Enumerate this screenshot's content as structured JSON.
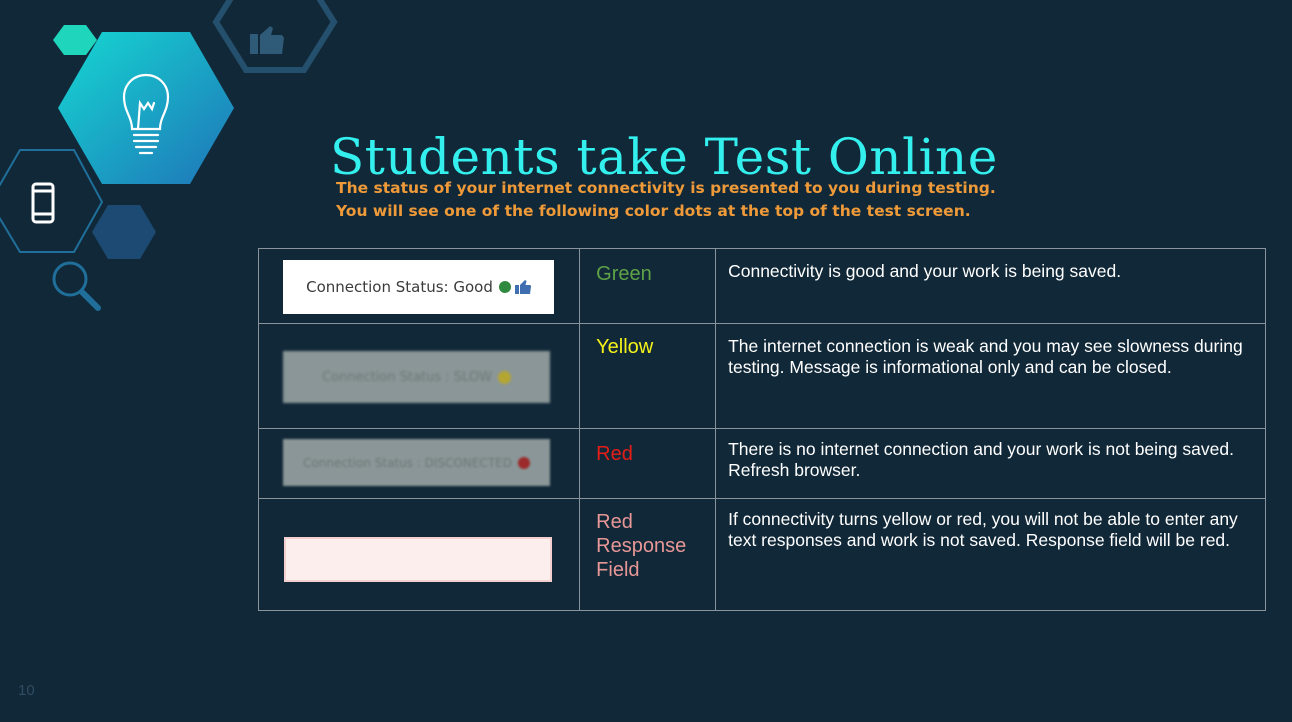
{
  "slide": {
    "title": "Students take Test Online",
    "subtitle_lines": [
      "The status of your internet connectivity is presented to you during testing.",
      "You will see one of the following color dots at the top of the test screen."
    ],
    "page_number": "10"
  },
  "table": {
    "rows": [
      {
        "screenshot_label": "Connection Status: Good",
        "color_name": "Green",
        "color_hex": "#5ea247",
        "description": "Connectivity is good and your work is being saved."
      },
      {
        "screenshot_label": "Connection Status : SLOW",
        "color_name": "Yellow",
        "color_hex": "#f4f21a",
        "description": "The internet connection is weak and you may see slowness during testing. Message is informational only and can be closed."
      },
      {
        "screenshot_label": "Connection Status : DISCONECTED",
        "color_name": "Red",
        "color_hex": "#e51d18",
        "description": "There is no internet connection and your work is not being saved. Refresh browser."
      },
      {
        "screenshot_label": "",
        "color_name_lines": [
          "Red",
          "Response",
          "Field"
        ],
        "color_hex": "#e89797",
        "description": "If connectivity turns yellow or red, you will not be able to enter any text responses and work is not saved. Response field will be red."
      }
    ]
  },
  "colors": {
    "background": "#112838",
    "title": "#33f0ee",
    "subtitle": "#ef9a39",
    "hex_accent": "#1ab8c8",
    "hex_outline": "#24506e"
  },
  "icons": [
    "lightbulb-icon",
    "thumbs-up-icon",
    "smartphone-icon",
    "magnifier-icon"
  ]
}
